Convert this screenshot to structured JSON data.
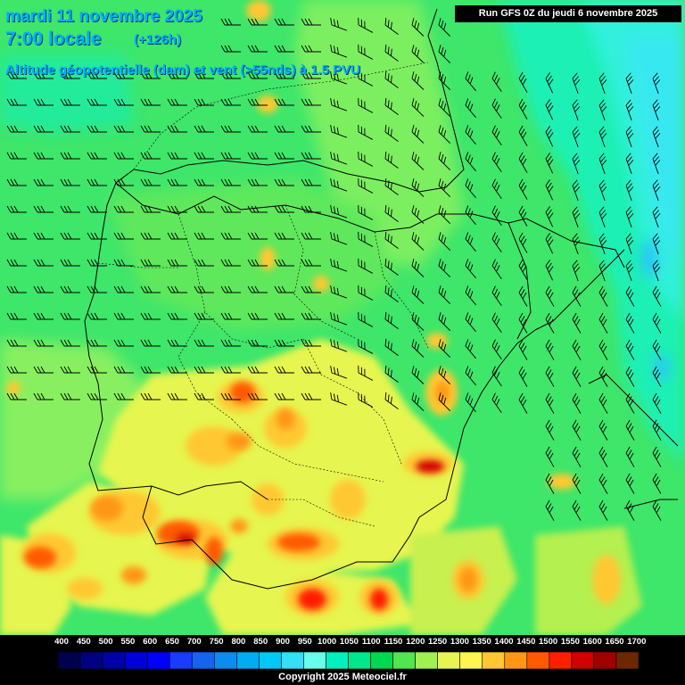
{
  "header": {
    "date": "mardi 11 novembre 2025",
    "time": "7:00 locale",
    "lead": "(+126h)",
    "field": "Altitude géopotentielle (dam) et vent (>55nds) à 1.5 PVU",
    "run": "Run GFS 0Z du jeudi 6 novembre 2025"
  },
  "legend": {
    "labels": [
      "400",
      "450",
      "500",
      "550",
      "600",
      "650",
      "700",
      "750",
      "800",
      "850",
      "900",
      "950",
      "1000",
      "1050",
      "1100",
      "1150",
      "1200",
      "1250",
      "1300",
      "1350",
      "1400",
      "1450",
      "1500",
      "1550",
      "1600",
      "1650",
      "1700"
    ],
    "colors": [
      "#000000",
      "#00004d",
      "#000080",
      "#0000a8",
      "#0000d8",
      "#0000ff",
      "#1a3cff",
      "#1464f0",
      "#0a8cf0",
      "#00aaf5",
      "#00c8f5",
      "#33e0f5",
      "#66ffee",
      "#00f0c0",
      "#00e68c",
      "#00d850",
      "#50e650",
      "#a0f050",
      "#e6f550",
      "#fff550",
      "#ffc832",
      "#ff9614",
      "#ff5a00",
      "#ff1e00",
      "#d20000",
      "#a00000",
      "#6e2800"
    ]
  },
  "copyright": "Copyright 2025 Meteociel.fr"
}
